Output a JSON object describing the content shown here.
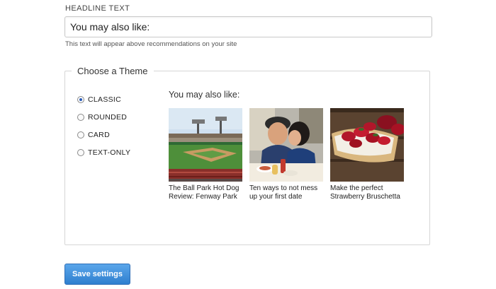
{
  "headline": {
    "label": "HEADLINE TEXT",
    "value": "You may also like:",
    "help": "This text will appear above recommendations on your site"
  },
  "theme": {
    "legend": "Choose a Theme",
    "options": [
      {
        "label": "CLASSIC",
        "selected": true
      },
      {
        "label": "ROUNDED",
        "selected": false
      },
      {
        "label": "CARD",
        "selected": false
      },
      {
        "label": "TEXT-ONLY",
        "selected": false
      }
    ]
  },
  "preview": {
    "heading": "You may also like:",
    "items": [
      {
        "caption": "The Ball Park Hot Dog Review: Fenway Park",
        "image": "baseball-stadium-photo"
      },
      {
        "caption": "Ten ways to not mess up your first date",
        "image": "couple-kissing-photo"
      },
      {
        "caption": "Make the perfect Strawberry Bruschetta",
        "image": "strawberry-bruschetta-photo"
      }
    ]
  },
  "actions": {
    "save_label": "Save settings"
  },
  "colors": {
    "button": "#3a87d6",
    "radio_selected": "#2b5cb8",
    "border": "#d6d6d6"
  }
}
